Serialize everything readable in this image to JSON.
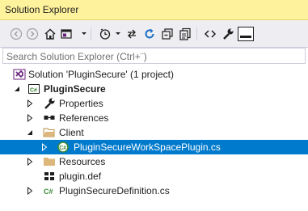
{
  "window": {
    "title": "Solution Explorer"
  },
  "search": {
    "placeholder": "Search Solution Explorer (Ctrl+¨)"
  },
  "tree": {
    "solution": "Solution 'PluginSecure' (1 project)",
    "project": "PluginSecure",
    "properties": "Properties",
    "references": "References",
    "client": "Client",
    "selected_file": "PluginSecureWorkSpacePlugin.cs",
    "resources": "Resources",
    "plugin_def": "plugin.def",
    "definition_file": "PluginSecureDefinition.cs"
  },
  "colors": {
    "title_bg": "#fff29d",
    "toolbar_bg": "#eeeef2",
    "selection": "#007acc",
    "folder": "#dcb67a",
    "csharp": "#388a34",
    "vs_purple": "#68217a"
  },
  "icons": {
    "toolbar": [
      "back-icon",
      "forward-icon",
      "home-icon",
      "switch-views-icon",
      "pending-changes-icon",
      "sync-icon",
      "refresh-icon",
      "collapse-all-icon",
      "show-all-files-icon",
      "view-code-icon",
      "properties-icon",
      "preview-icon"
    ]
  }
}
